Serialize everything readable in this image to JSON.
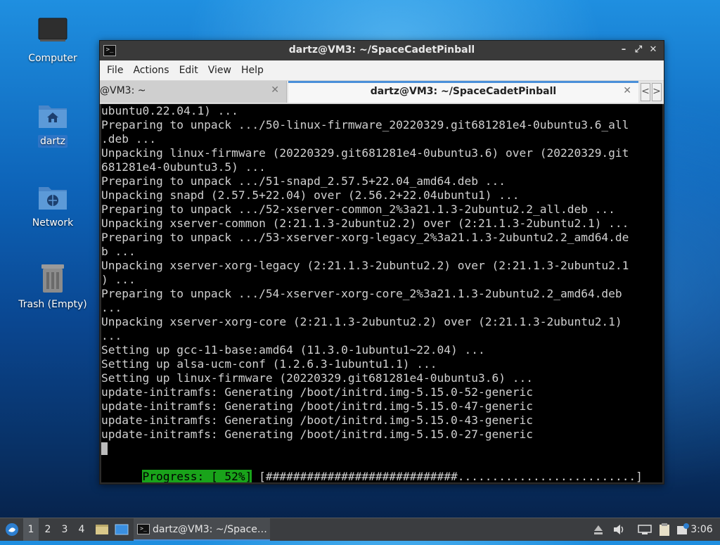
{
  "desktop": {
    "icons": [
      {
        "label": "Computer"
      },
      {
        "label": "dartz"
      },
      {
        "label": "Network"
      },
      {
        "label": "Trash (Empty)"
      }
    ]
  },
  "window": {
    "title": "dartz@VM3: ~/SpaceCadetPinball",
    "menu": [
      "File",
      "Actions",
      "Edit",
      "View",
      "Help"
    ],
    "tabs": [
      {
        "label": "@VM3: ~",
        "active": false
      },
      {
        "label": "dartz@VM3: ~/SpaceCadetPinball",
        "active": true
      }
    ],
    "tab_nav": {
      "prev": "<",
      "next": ">"
    }
  },
  "terminal": {
    "lines": [
      "ubuntu0.22.04.1) ...",
      "Preparing to unpack .../50-linux-firmware_20220329.git681281e4-0ubuntu3.6_all",
      ".deb ...",
      "Unpacking linux-firmware (20220329.git681281e4-0ubuntu3.6) over (20220329.git",
      "681281e4-0ubuntu3.5) ...",
      "Preparing to unpack .../51-snapd_2.57.5+22.04_amd64.deb ...",
      "Unpacking snapd (2.57.5+22.04) over (2.56.2+22.04ubuntu1) ...",
      "Preparing to unpack .../52-xserver-common_2%3a21.1.3-2ubuntu2.2_all.deb ...",
      "Unpacking xserver-common (2:21.1.3-2ubuntu2.2) over (2:21.1.3-2ubuntu2.1) ...",
      "Preparing to unpack .../53-xserver-xorg-legacy_2%3a21.1.3-2ubuntu2.2_amd64.de",
      "b ...",
      "Unpacking xserver-xorg-legacy (2:21.1.3-2ubuntu2.2) over (2:21.1.3-2ubuntu2.1",
      ") ...",
      "Preparing to unpack .../54-xserver-xorg-core_2%3a21.1.3-2ubuntu2.2_amd64.deb",
      "...",
      "Unpacking xserver-xorg-core (2:21.1.3-2ubuntu2.2) over (2:21.1.3-2ubuntu2.1)",
      "...",
      "Setting up gcc-11-base:amd64 (11.3.0-1ubuntu1~22.04) ...",
      "Setting up alsa-ucm-conf (1.2.6.3-1ubuntu1.1) ...",
      "Setting up linux-firmware (20220329.git681281e4-0ubuntu3.6) ...",
      "update-initramfs: Generating /boot/initrd.img-5.15.0-52-generic",
      "update-initramfs: Generating /boot/initrd.img-5.15.0-47-generic",
      "update-initramfs: Generating /boot/initrd.img-5.15.0-43-generic",
      "update-initramfs: Generating /boot/initrd.img-5.15.0-27-generic"
    ],
    "progress_label": "Progress: [ 52%]",
    "progress_bar": " [############################..........................]",
    "progress_percent": 52
  },
  "taskbar": {
    "workspaces": [
      "1",
      "2",
      "3",
      "4"
    ],
    "active_workspace": "1",
    "task_label": "dartz@VM3: ~/Space…",
    "clock": "3:06"
  },
  "colors": {
    "progress_green": "#19a31a",
    "tab_accent": "#4a90d9"
  }
}
